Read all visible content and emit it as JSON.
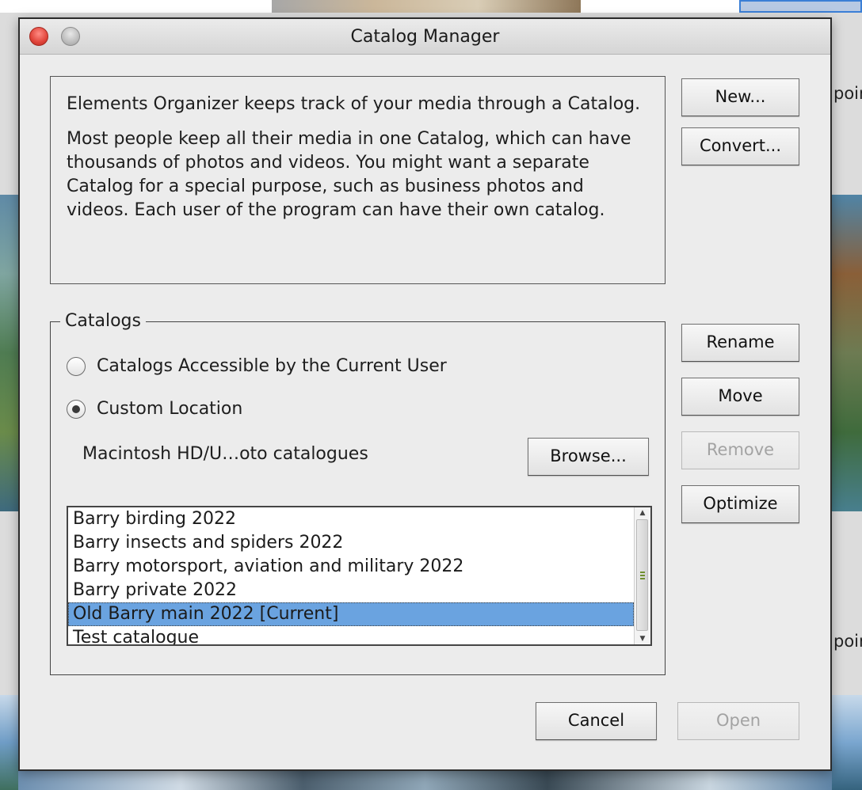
{
  "background": {
    "right_label_top": "poin",
    "right_label_bottom": "poin"
  },
  "dialog": {
    "title": "Catalog Manager",
    "description": [
      "Elements Organizer keeps track of your media through a Catalog.",
      "Most people keep all their media in one Catalog, which can have thousands of photos and videos. You might want a separate Catalog for a special purpose, such as business photos and videos. Each user of the program can have their own catalog."
    ],
    "buttons": {
      "new": "New...",
      "convert": "Convert...",
      "rename": "Rename",
      "move": "Move",
      "remove": "Remove",
      "optimize": "Optimize",
      "browse": "Browse...",
      "cancel": "Cancel",
      "open": "Open"
    },
    "disabled_buttons": [
      "remove",
      "open"
    ],
    "catalogs_group": {
      "legend": "Catalogs",
      "radio_current_user": "Catalogs Accessible by the Current User",
      "radio_custom_location": "Custom Location",
      "selected_radio": "custom_location",
      "location_path": "Macintosh HD/U…oto catalogues",
      "items": [
        "Barry birding 2022",
        "Barry insects and spiders 2022",
        "Barry motorsport, aviation and military 2022",
        "Barry private 2022",
        "Old Barry main 2022 [Current]",
        "Test catalogue"
      ],
      "selected_index": 4
    }
  },
  "colors": {
    "selection": "#6aa3e0",
    "close_button": "#e0443a"
  }
}
